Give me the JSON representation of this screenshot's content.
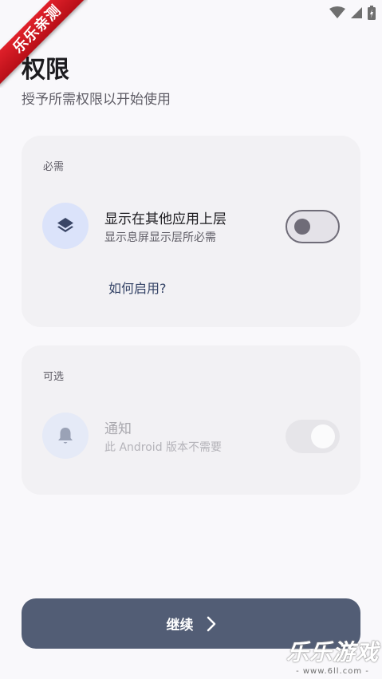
{
  "corner_badge": "乐乐亲测",
  "header": {
    "title": "权限",
    "subtitle": "授予所需权限以开始使用"
  },
  "required_section": {
    "label": "必需",
    "permission": {
      "title": "显示在其他应用上层",
      "description": "显示息屏显示层所必需",
      "icon": "layers-icon",
      "enabled": false
    },
    "how_to_link": "如何启用?"
  },
  "optional_section": {
    "label": "可选",
    "permission": {
      "title": "通知",
      "description": "此 Android 版本不需要",
      "icon": "bell-icon",
      "enabled": true,
      "disabled": true
    }
  },
  "continue_button": {
    "label": "继续",
    "icon": "chevron-right-icon"
  },
  "watermark": {
    "text": "乐乐游戏",
    "url": "- www.6ll.com -"
  },
  "colors": {
    "background": "#f9f8fb",
    "card": "#f2f1f4",
    "primary_button": "#525d75",
    "link": "#344366",
    "icon_circle": "#dbe3fa"
  }
}
